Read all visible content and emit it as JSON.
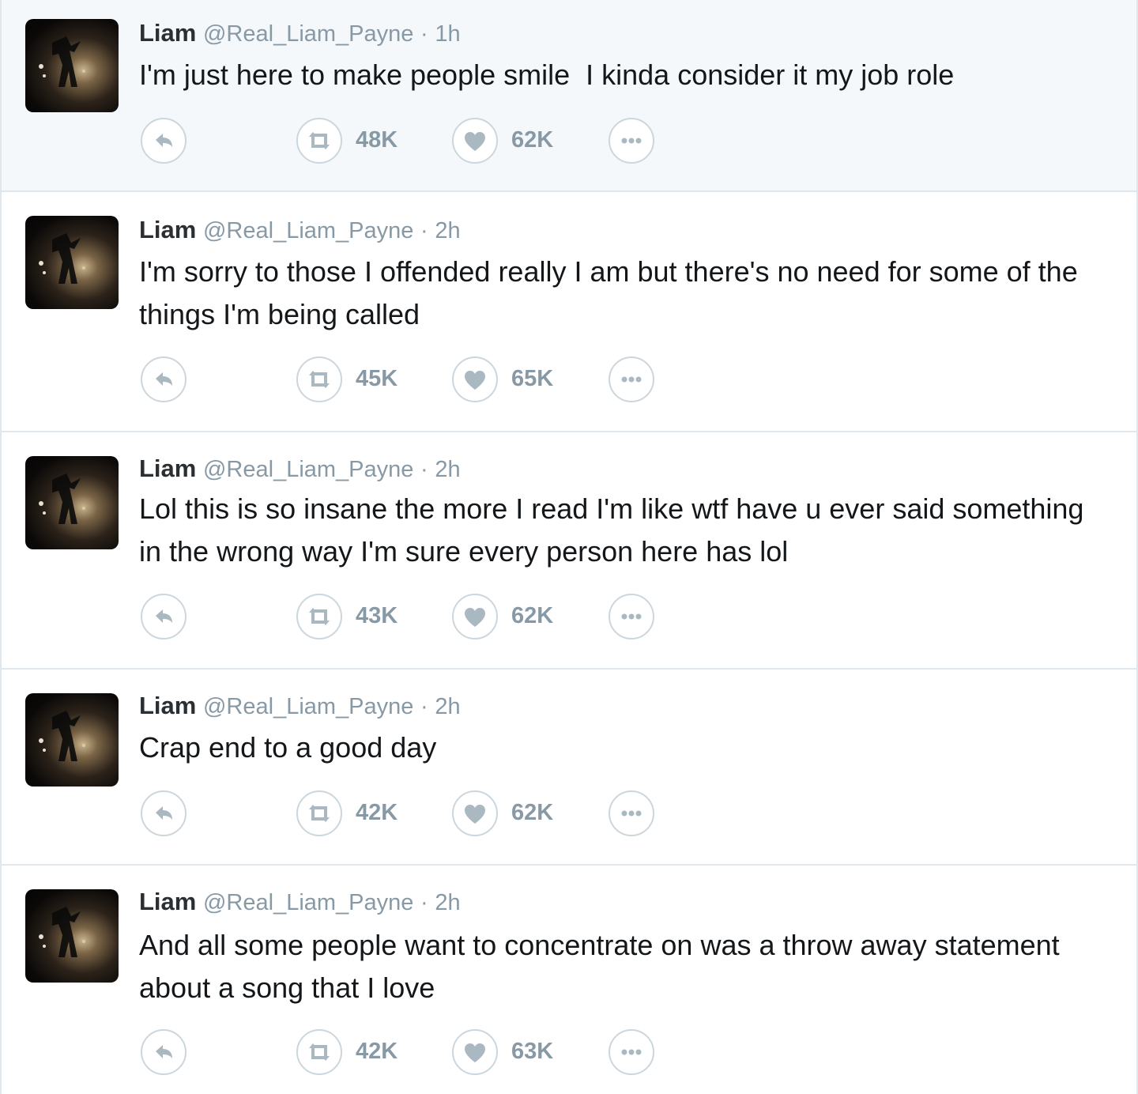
{
  "tweets": [
    {
      "name": "Liam",
      "handle": "@Real_Liam_Payne",
      "separator": "·",
      "time": "1h",
      "text": "I'm just here to make people smile  I kinda consider it my job role",
      "retweets": "48K",
      "likes": "62K",
      "highlighted": true
    },
    {
      "name": "Liam",
      "handle": "@Real_Liam_Payne",
      "separator": "·",
      "time": "2h",
      "text": "I'm sorry to those I offended really I am but there's no need for some of the things I'm being called",
      "retweets": "45K",
      "likes": "65K",
      "highlighted": false
    },
    {
      "name": "Liam",
      "handle": "@Real_Liam_Payne",
      "separator": "·",
      "time": "2h",
      "text": "Lol this is so insane the more I read I'm like wtf have u ever said something in the wrong way I'm sure every person here has lol",
      "retweets": "43K",
      "likes": "62K",
      "highlighted": false
    },
    {
      "name": "Liam",
      "handle": "@Real_Liam_Payne",
      "separator": "·",
      "time": "2h",
      "text": "Crap end to a good day",
      "retweets": "42K",
      "likes": "62K",
      "highlighted": false
    },
    {
      "name": "Liam",
      "handle": "@Real_Liam_Payne",
      "separator": "·",
      "time": "2h",
      "text": "And all some people want to concentrate on was a throw away statement about a song that I love",
      "retweets": "42K",
      "likes": "63K",
      "highlighted": false
    }
  ],
  "icons": {
    "reply": "reply-arrow-icon",
    "retweet": "retweet-icon",
    "like": "heart-icon",
    "more": "more-dots-icon"
  },
  "colors": {
    "icon_gray": "#aab8c2",
    "handle_gray": "#8899a6",
    "divider": "#e1e8ed",
    "highlight_bg": "#f5f8fa"
  }
}
